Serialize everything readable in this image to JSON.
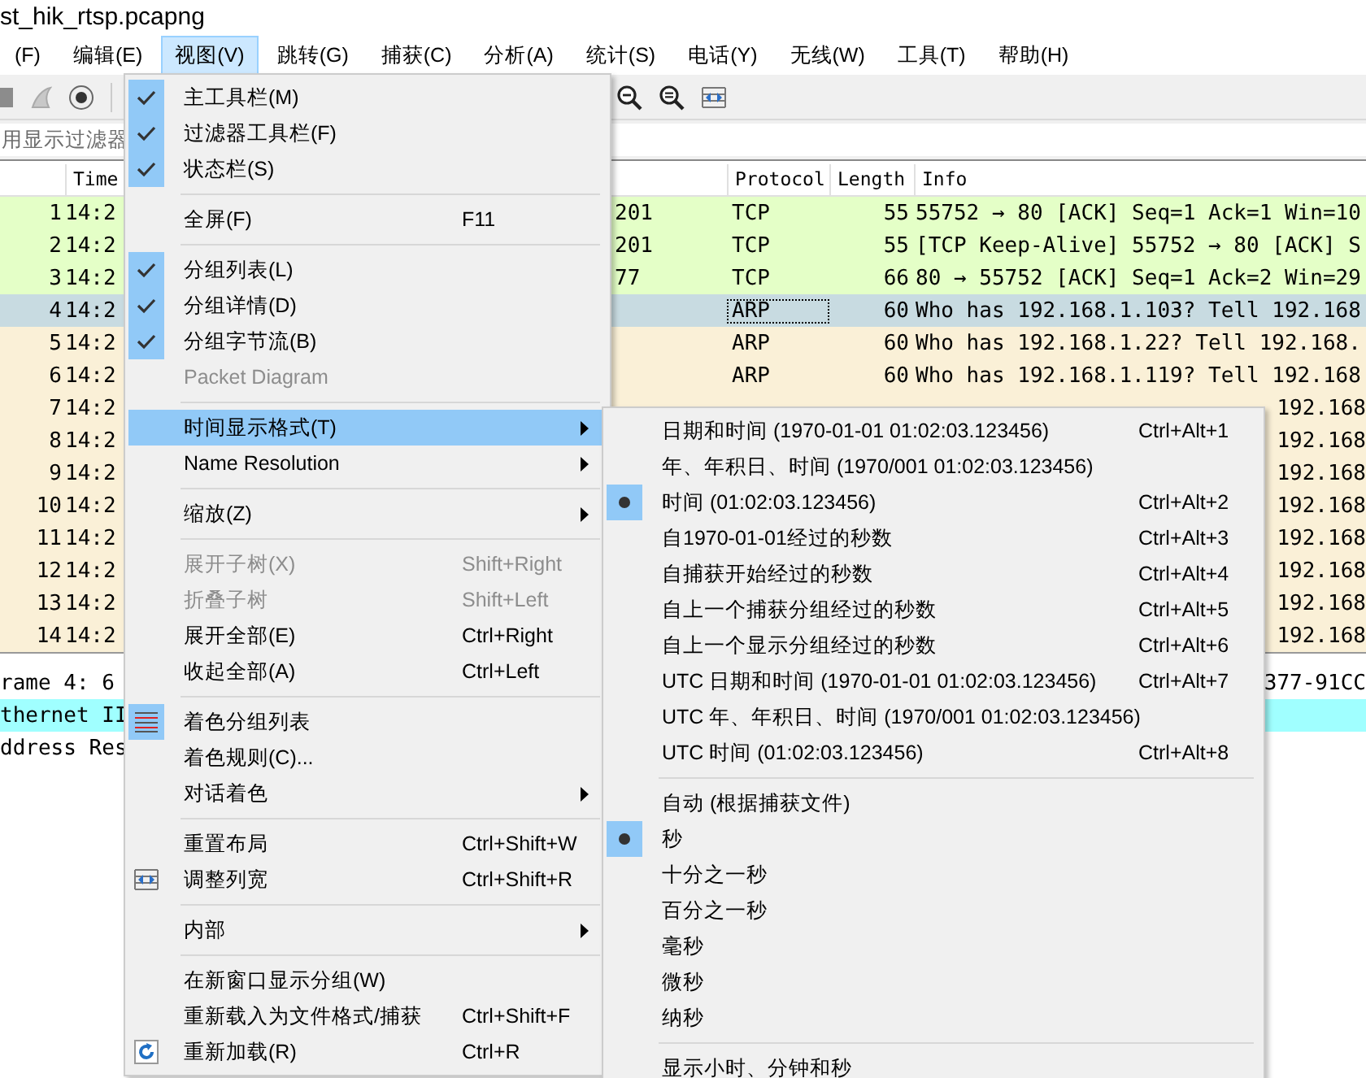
{
  "window": {
    "title": "st_hik_rtsp.pcapng"
  },
  "menubar": [
    {
      "label": "(F)",
      "selected": false
    },
    {
      "label": "编辑(E)",
      "selected": false
    },
    {
      "label": "视图(V)",
      "selected": true
    },
    {
      "label": "跳转(G)",
      "selected": false
    },
    {
      "label": "捕获(C)",
      "selected": false
    },
    {
      "label": "分析(A)",
      "selected": false
    },
    {
      "label": "统计(S)",
      "selected": false
    },
    {
      "label": "电话(Y)",
      "selected": false
    },
    {
      "label": "无线(W)",
      "selected": false
    },
    {
      "label": "工具(T)",
      "selected": false
    },
    {
      "label": "帮助(H)",
      "selected": false
    }
  ],
  "filter": {
    "placeholder": "用显示过滤器"
  },
  "packet_list": {
    "header": {
      "time": "Time",
      "protocol": "Protocol",
      "length": "Length",
      "info": "Info"
    },
    "rows": [
      {
        "number": "1",
        "time": "14:2",
        "column_3": "201",
        "protocol": "TCP",
        "length": "55",
        "info": "55752 → 80 [ACK] Seq=1 Ack=1 Win=10",
        "color": "#e4ffc7",
        "selected": false
      },
      {
        "number": "2",
        "time": "14:2",
        "column_3": "201",
        "protocol": "TCP",
        "length": "55",
        "info": "[TCP Keep-Alive] 55752 → 80 [ACK] S",
        "color": "#e4ffc7",
        "selected": false
      },
      {
        "number": "3",
        "time": "14:2",
        "column_3": "77",
        "protocol": "TCP",
        "length": "66",
        "info": "80 → 55752 [ACK] Seq=1 Ack=2 Win=29",
        "color": "#e4ffc7",
        "selected": false
      },
      {
        "number": "4",
        "time": "14:2",
        "protocol": "ARP",
        "length": "60",
        "info": "Who has 192.168.1.103? Tell 192.168",
        "selected": true
      },
      {
        "number": "5",
        "time": "14:2",
        "protocol": "ARP",
        "length": "60",
        "info": "Who has 192.168.1.22? Tell 192.168.",
        "color": "#faf0d7",
        "selected": false
      },
      {
        "number": "6",
        "time": "14:2",
        "protocol": "ARP",
        "length": "60",
        "info": "Who has 192.168.1.119? Tell 192.168",
        "color": "#faf0d7",
        "selected": false
      },
      {
        "number": "7",
        "time": "14:2",
        "info_tail": "192.168",
        "color": "#faf0d7",
        "selected": false
      },
      {
        "number": "8",
        "time": "14:2",
        "info_tail": "192.168",
        "color": "#faf0d7",
        "selected": false
      },
      {
        "number": "9",
        "time": "14:2",
        "info_tail": "192.168",
        "color": "#faf0d7",
        "selected": false
      },
      {
        "number": "10",
        "time": "14:2",
        "info_tail": "192.168",
        "color": "#faf0d7",
        "selected": false
      },
      {
        "number": "11",
        "time": "14:2",
        "info_tail": "192.168",
        "color": "#faf0d7",
        "selected": false
      },
      {
        "number": "12",
        "time": "14:2",
        "info_tail": "192.168",
        "color": "#faf0d7",
        "selected": false
      },
      {
        "number": "13",
        "time": "14:2",
        "info_tail": "192.168",
        "color": "#faf0d7",
        "selected": false
      },
      {
        "number": "14",
        "time": "14:2",
        "info_tail": "192.168",
        "color": "#faf0d7",
        "selected": false
      }
    ]
  },
  "details": [
    {
      "text": "rame 4: 6",
      "tail": "377-91CC",
      "selected": false
    },
    {
      "text": "thernet II",
      "selected": true
    },
    {
      "text": "ddress Res",
      "selected": false
    }
  ],
  "view_menu": [
    {
      "kind": "check",
      "label": "主工具栏(M)",
      "checked": true
    },
    {
      "kind": "check",
      "label": "过滤器工具栏(F)",
      "checked": true
    },
    {
      "kind": "check",
      "label": "状态栏(S)",
      "checked": true
    },
    {
      "kind": "separator"
    },
    {
      "kind": "plain",
      "label": "全屏(F)",
      "shortcut": "F11"
    },
    {
      "kind": "separator"
    },
    {
      "kind": "check",
      "label": "分组列表(L)",
      "checked": true
    },
    {
      "kind": "check",
      "label": "分组详情(D)",
      "checked": true
    },
    {
      "kind": "check",
      "label": "分组字节流(B)",
      "checked": true
    },
    {
      "kind": "plain",
      "label": "Packet Diagram",
      "disabled": true
    },
    {
      "kind": "separator"
    },
    {
      "kind": "submenu",
      "label": "时间显示格式(T)",
      "selected": true
    },
    {
      "kind": "submenu",
      "label": "Name Resolution",
      "selected": false
    },
    {
      "kind": "separator"
    },
    {
      "kind": "submenu",
      "label": "缩放(Z)",
      "selected": false
    },
    {
      "kind": "separator"
    },
    {
      "kind": "plain",
      "label": "展开子树(X)",
      "shortcut": "Shift+Right",
      "disabled": true
    },
    {
      "kind": "plain",
      "label": "折叠子树",
      "shortcut": "Shift+Left",
      "disabled": true
    },
    {
      "kind": "plain",
      "label": "展开全部(E)",
      "shortcut": "Ctrl+Right",
      "disabled": false
    },
    {
      "kind": "plain",
      "label": "收起全部(A)",
      "shortcut": "Ctrl+Left",
      "disabled": false
    },
    {
      "kind": "separator"
    },
    {
      "kind": "coloring",
      "label": "着色分组列表",
      "checked": true
    },
    {
      "kind": "plain",
      "label": "着色规则(C)..."
    },
    {
      "kind": "submenu",
      "label": "对话着色",
      "selected": false
    },
    {
      "kind": "separator"
    },
    {
      "kind": "plain",
      "label": "重置布局",
      "shortcut": "Ctrl+Shift+W"
    },
    {
      "kind": "resize",
      "label": "调整列宽",
      "shortcut": "Ctrl+Shift+R"
    },
    {
      "kind": "separator"
    },
    {
      "kind": "submenu",
      "label": "内部",
      "selected": false
    },
    {
      "kind": "separator"
    },
    {
      "kind": "plain",
      "label": "在新窗口显示分组(W)"
    },
    {
      "kind": "plain",
      "label": "重新载入为文件格式/捕获",
      "shortcut": "Ctrl+Shift+F"
    },
    {
      "kind": "reload",
      "label": "重新加载(R)",
      "shortcut": "Ctrl+R"
    }
  ],
  "time_format_menu": [
    {
      "kind": "radio",
      "label": "日期和时间 (1970-01-01 01:02:03.123456)",
      "shortcut": "Ctrl+Alt+1",
      "selected": false
    },
    {
      "kind": "radio",
      "label": "年、年积日、时间 (1970/001 01:02:03.123456)",
      "selected": false
    },
    {
      "kind": "radio",
      "label": "时间 (01:02:03.123456)",
      "shortcut": "Ctrl+Alt+2",
      "selected": true
    },
    {
      "kind": "radio",
      "label": "自1970-01-01经过的秒数",
      "shortcut": "Ctrl+Alt+3",
      "selected": false
    },
    {
      "kind": "radio",
      "label": "自捕获开始经过的秒数",
      "shortcut": "Ctrl+Alt+4",
      "selected": false
    },
    {
      "kind": "radio",
      "label": "自上一个捕获分组经过的秒数",
      "shortcut": "Ctrl+Alt+5",
      "selected": false
    },
    {
      "kind": "radio",
      "label": "自上一个显示分组经过的秒数",
      "shortcut": "Ctrl+Alt+6",
      "selected": false
    },
    {
      "kind": "radio",
      "label": "UTC 日期和时间 (1970-01-01 01:02:03.123456)",
      "shortcut": "Ctrl+Alt+7",
      "selected": false
    },
    {
      "kind": "radio",
      "label": "UTC 年、年积日、时间 (1970/001 01:02:03.123456)",
      "selected": false
    },
    {
      "kind": "radio",
      "label": "UTC 时间 (01:02:03.123456)",
      "shortcut": "Ctrl+Alt+8",
      "selected": false
    },
    {
      "kind": "separator"
    },
    {
      "kind": "radio",
      "label": "自动 (根据捕获文件)",
      "selected": false
    },
    {
      "kind": "radio",
      "label": "秒",
      "selected": true
    },
    {
      "kind": "radio",
      "label": "十分之一秒",
      "selected": false
    },
    {
      "kind": "radio",
      "label": "百分之一秒",
      "selected": false
    },
    {
      "kind": "radio",
      "label": "毫秒",
      "selected": false
    },
    {
      "kind": "radio",
      "label": "微秒",
      "selected": false
    },
    {
      "kind": "radio",
      "label": "纳秒",
      "selected": false
    },
    {
      "kind": "separator"
    },
    {
      "kind": "plain",
      "label": "显示小时、分钟和秒"
    }
  ]
}
